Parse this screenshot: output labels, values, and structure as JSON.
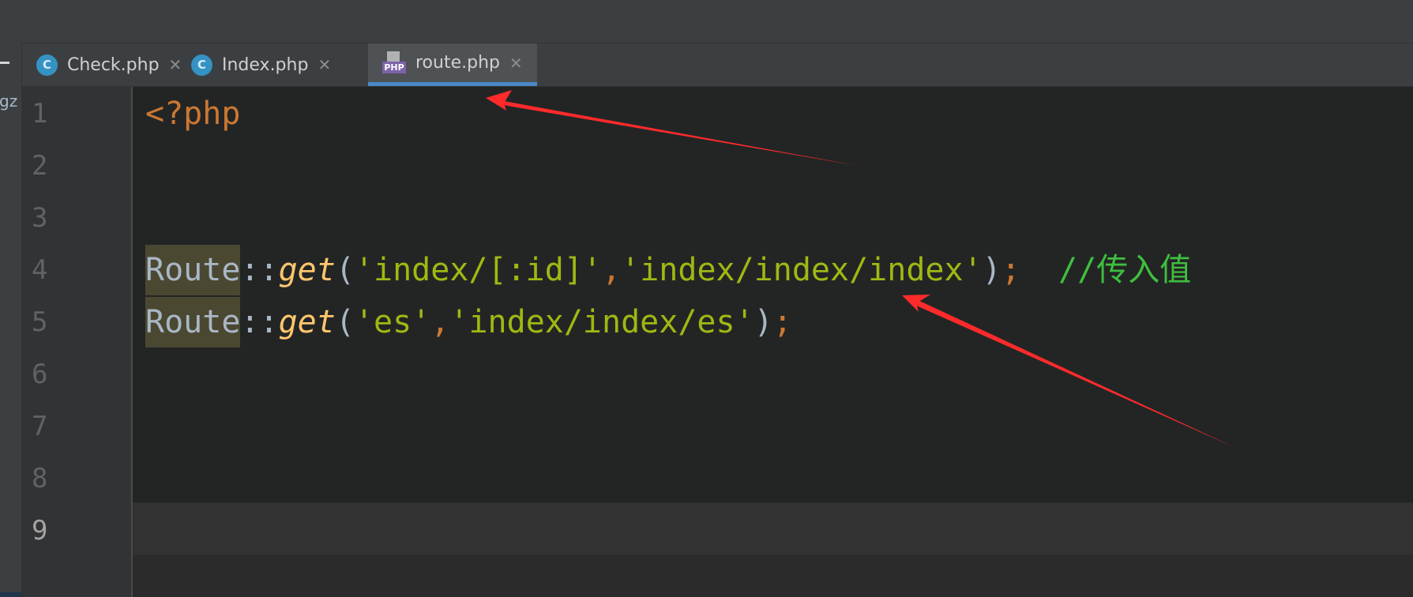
{
  "left_panel": {
    "truncated_label": "gz"
  },
  "tabs": [
    {
      "label": "Check.php",
      "icon": "class-icon",
      "icon_glyph": "C",
      "active": false
    },
    {
      "label": "Index.php",
      "icon": "class-icon",
      "icon_glyph": "C",
      "active": false
    },
    {
      "label": "route.php",
      "icon": "php-file-icon",
      "icon_glyph": "PHP",
      "active": true
    }
  ],
  "tab_close_glyph": "✕",
  "gutter": {
    "line_numbers": [
      "1",
      "2",
      "3",
      "4",
      "5",
      "6",
      "7",
      "8",
      "9"
    ],
    "current_line": "9"
  },
  "code": {
    "line1": {
      "open_tag": "<?php"
    },
    "line4": {
      "class": "Route",
      "op": "::",
      "func": "get",
      "paren_open": "(",
      "arg1": "'index/[:id]'",
      "comma": ",",
      "arg2": "'index/index/index'",
      "paren_close": ")",
      "semicolon": ";",
      "gap": "  ",
      "comment": "//传入值"
    },
    "line5": {
      "class": "Route",
      "op": "::",
      "func": "get",
      "paren_open": "(",
      "arg1": "'es'",
      "comma": ",",
      "arg2": "'index/index/es'",
      "paren_close": ")",
      "semicolon": ";"
    }
  },
  "colors": {
    "keyword_tag": "#cc7832",
    "string": "#a0b812",
    "function": "#ffc66d",
    "comment": "#3fbf3f",
    "annotation_arrow": "#ff2b2b",
    "active_tab_underline": "#4a88c7"
  }
}
